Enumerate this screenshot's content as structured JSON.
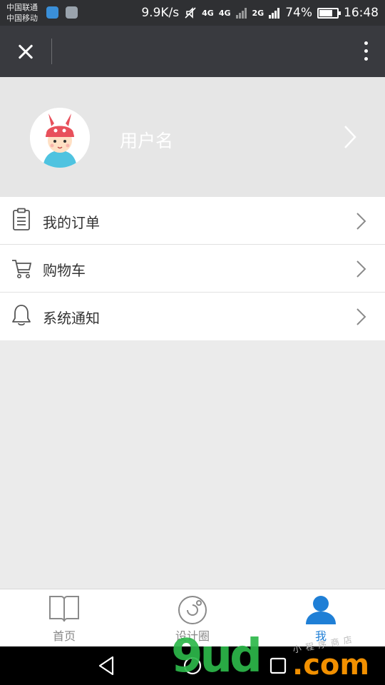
{
  "status_bar": {
    "carrier_1": "中国联通",
    "carrier_2": "中国移动",
    "speed": "9.9K/s",
    "net_badge_1": "4G",
    "net_badge_2": "4G",
    "net_badge_3": "2G",
    "battery_percent_label": "74%",
    "battery_level": 0.74,
    "time": "16:48"
  },
  "title_bar": {
    "close_icon": "close-icon",
    "more_icon": "more-vertical-icon"
  },
  "profile": {
    "username": "用户名",
    "avatar_icon": "avatar-cartoon-boy"
  },
  "menu": {
    "items": [
      {
        "icon": "clipboard-icon",
        "label": "我的订单"
      },
      {
        "icon": "cart-icon",
        "label": "购物车"
      },
      {
        "icon": "bell-icon",
        "label": "系统通知"
      }
    ]
  },
  "tab_bar": {
    "tabs": [
      {
        "icon": "book-icon",
        "label": "首页"
      },
      {
        "icon": "circle-icon",
        "label": "设计圈"
      },
      {
        "icon": "person-icon",
        "label": "我"
      }
    ],
    "active_index": 2,
    "active_color": "#1f7fd6",
    "inactive_color": "#888888"
  },
  "watermark": {
    "brand": "9ud",
    "suffix": ".com",
    "tagline": "小程序商店"
  }
}
